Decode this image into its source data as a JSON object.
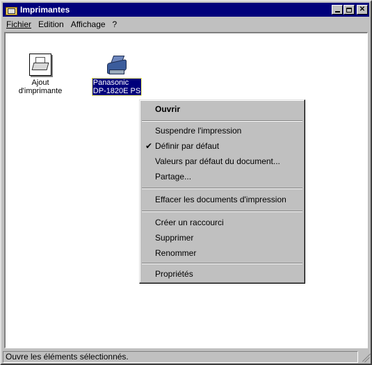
{
  "window": {
    "title": "Imprimantes"
  },
  "menubar": {
    "items": [
      {
        "label": "Fichier",
        "mnemonic": "F"
      },
      {
        "label": "Edition",
        "mnemonic": "E"
      },
      {
        "label": "Affichage",
        "mnemonic": "A"
      },
      {
        "label": "?",
        "mnemonic": "?"
      }
    ]
  },
  "icons": {
    "add_printer": {
      "label_line1": "Ajout",
      "label_line2": "d'imprimante"
    },
    "panasonic": {
      "label_line1": "Panasonic",
      "label_line2": "DP-1820E PS"
    }
  },
  "context_menu": {
    "open": "Ouvrir",
    "pause": "Suspendre l'impression",
    "set_default": "Définir par défaut",
    "document_defaults": "Valeurs par défaut du document...",
    "sharing": "Partage...",
    "purge": "Effacer les documents d'impression",
    "create_shortcut": "Créer un raccourci",
    "delete": "Supprimer",
    "rename": "Renommer",
    "properties": "Propriétés",
    "checkmark": "✔"
  },
  "statusbar": {
    "text": "Ouvre les éléments sélectionnés."
  }
}
